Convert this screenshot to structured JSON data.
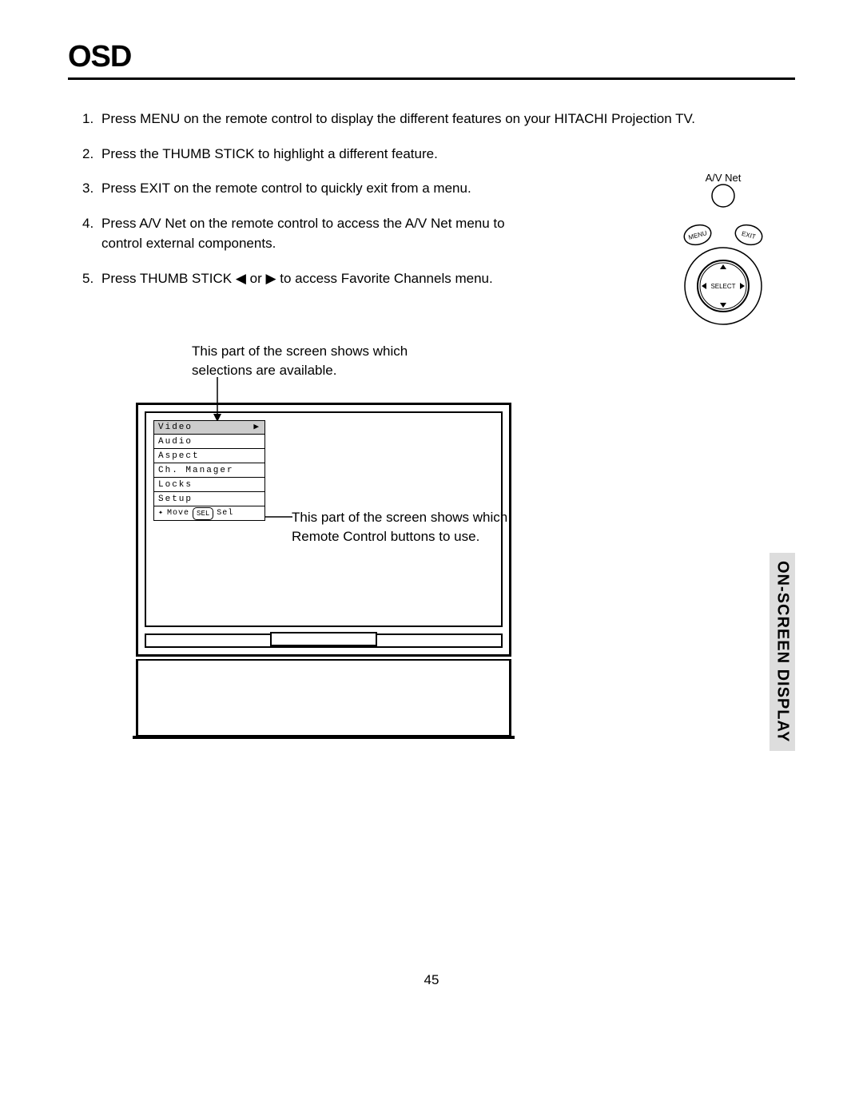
{
  "title": "OSD",
  "instructions": [
    "Press MENU on the remote control to display the different features on your HITACHI Projection TV.",
    "Press the THUMB STICK to highlight a different feature.",
    "Press EXIT on the remote control to quickly exit from a menu.",
    "Press A/V Net on the remote control to access the A/V Net menu to control external components.",
    "Press THUMB STICK ◀ or ▶ to access Favorite Channels menu."
  ],
  "remote": {
    "av_net_label": "A/V Net",
    "menu_btn": "MENU",
    "exit_btn": "EXIT",
    "select_label": "SELECT"
  },
  "annotations": {
    "top": "This part of the screen shows which selections are available.",
    "right": "This part of the screen shows which Remote Control buttons to use."
  },
  "osd_menu": {
    "items": [
      "Video",
      "Audio",
      "Aspect",
      "Ch. Manager",
      "Locks",
      "Setup"
    ],
    "hint_move": "Move",
    "hint_sel_badge": "SEL",
    "hint_sel": "Sel"
  },
  "side_tab": "ON-SCREEN DISPLAY",
  "page_number": "45"
}
